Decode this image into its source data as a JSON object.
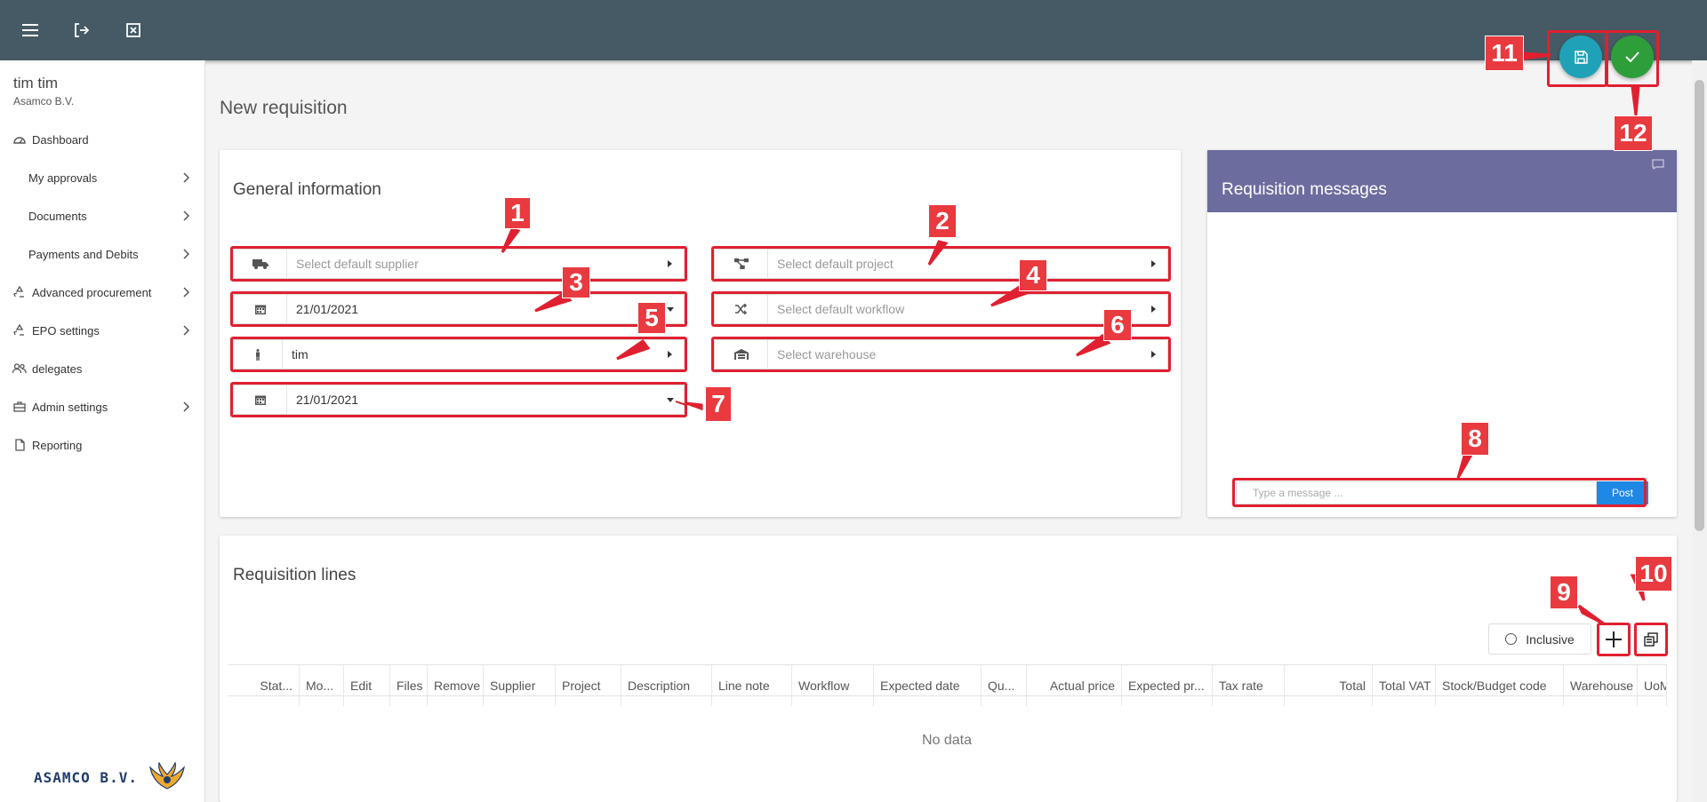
{
  "sidebar": {
    "user_name": "tim tim",
    "company": "Asamco B.V.",
    "items": [
      {
        "label": "Dashboard"
      },
      {
        "label": "My approvals"
      },
      {
        "label": "Documents"
      },
      {
        "label": "Payments and Debits"
      },
      {
        "label": "Advanced procurement"
      },
      {
        "label": "EPO settings"
      },
      {
        "label": "delegates"
      },
      {
        "label": "Admin settings"
      },
      {
        "label": "Reporting"
      }
    ],
    "brand": "ASAMCO B.V."
  },
  "page": {
    "title": "New requisition"
  },
  "general": {
    "title": "General information",
    "supplier_placeholder": "Select default supplier",
    "project_placeholder": "Select default project",
    "date1": "21/01/2021",
    "workflow_placeholder": "Select default workflow",
    "user_value": "tim",
    "warehouse_placeholder": "Select warehouse",
    "date2": "21/01/2021"
  },
  "messages": {
    "title": "Requisition messages",
    "input_placeholder": "Type a message ...",
    "post_label": "Post"
  },
  "lines": {
    "title": "Requisition lines",
    "inclusive_label": "Inclusive",
    "columns": [
      "Stat...",
      "Mo...",
      "Edit",
      "Files",
      "Remove",
      "Supplier",
      "Project",
      "Description",
      "Line note",
      "Workflow",
      "Expected date",
      "Qu...",
      "Actual price",
      "Expected pr...",
      "Tax rate",
      "Total",
      "Total VAT",
      "Stock/Budget code",
      "Warehouse",
      "UoM"
    ],
    "empty_text": "No data"
  },
  "annotations": [
    "1",
    "2",
    "3",
    "4",
    "5",
    "6",
    "7",
    "8",
    "9",
    "10",
    "11",
    "12"
  ],
  "colors": {
    "topbar": "#455a64",
    "messages_header": "#6d6c9e",
    "save_fab": "#1fa2b8",
    "submit_fab": "#2e9e3a",
    "annotation": "#e02030",
    "post_button": "#1e88e5"
  }
}
